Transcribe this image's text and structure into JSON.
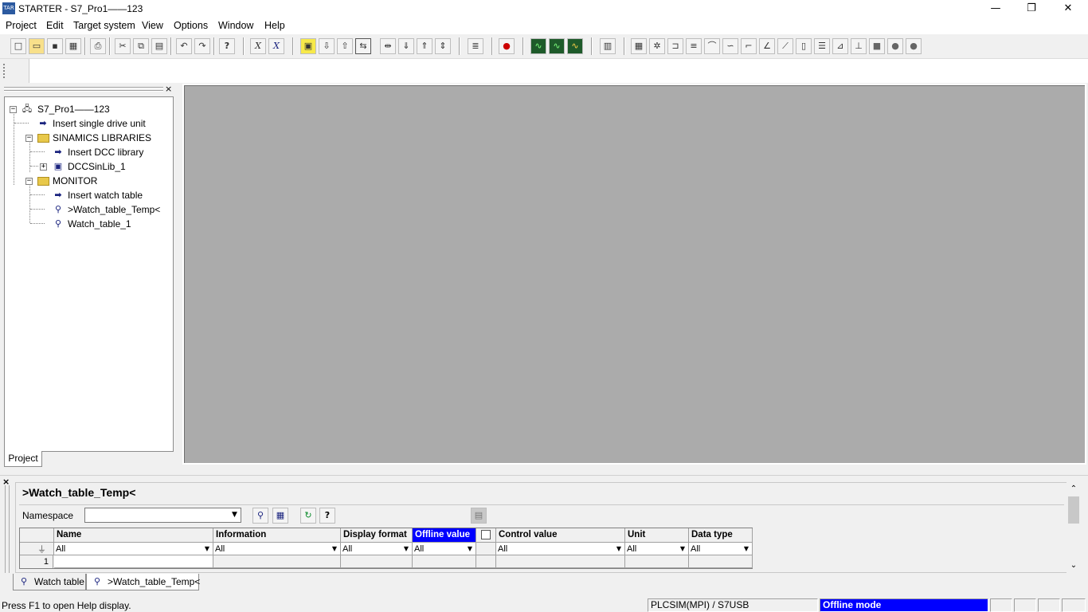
{
  "window": {
    "app_icon_text": "TAR",
    "title": "STARTER - S7_Pro1——123",
    "minimize": "—",
    "restore": "❐",
    "close": "✕"
  },
  "menu": [
    "Project",
    "Edit",
    "Target system",
    "View",
    "Options",
    "Window",
    "Help"
  ],
  "toolbar_icons": [
    "new-icon",
    "open-icon",
    "save-icon",
    "save-compile-icon",
    "print-icon",
    "cut-icon",
    "copy-icon",
    "paste-icon",
    "undo-icon",
    "redo-icon",
    "help-context-icon",
    "x-formula-icon",
    "x-formula-edit-icon",
    "accessible-nodes-icon",
    "load-icon",
    "upload-icon",
    "connect-icon",
    "disconnect-icon",
    "download-icon",
    "upload-cpu-icon",
    "transfer-icon",
    "compare-icon",
    "commissioning-icon",
    "trace-icon",
    "trace2-icon",
    "trace3-icon",
    "function-generator-icon",
    "param-icon",
    "gear-icon",
    "drive-icon",
    "lines-icon",
    "curve1-icon",
    "curve2-icon",
    "curve3-icon",
    "curve4-icon",
    "curve5-icon",
    "curve6-icon",
    "block-icon",
    "lines2-icon",
    "ramp1-icon",
    "ramp2-icon",
    "square-icon",
    "circle-icon",
    "circle2-icon"
  ],
  "project_tree": {
    "close_label": "×",
    "tab_label": "Project",
    "items": [
      {
        "label": "S7_Pro1——123",
        "expander": "−"
      },
      {
        "label": "Insert single drive unit"
      },
      {
        "label": "SINAMICS LIBRARIES",
        "expander": "−"
      },
      {
        "label": "Insert DCC library"
      },
      {
        "label": "DCCSinLib_1",
        "expander": "+"
      },
      {
        "label": "MONITOR",
        "expander": "−"
      },
      {
        "label": "Insert watch table"
      },
      {
        "label": ">Watch_table_Temp<"
      },
      {
        "label": "Watch_table_1"
      }
    ]
  },
  "detail": {
    "close_label": "×",
    "title": ">Watch_table_Temp<",
    "namespace_label": "Namespace",
    "namespace_value": "",
    "columns": [
      "Name",
      "Information",
      "Display format",
      "Offline value",
      "",
      "Control value",
      "Unit",
      "Data type"
    ],
    "filters": [
      "All",
      "All",
      "All",
      "All",
      "",
      "All",
      "All",
      "All"
    ],
    "row_number": "1",
    "tabs": [
      "Watch table",
      ">Watch_table_Temp<"
    ]
  },
  "status": {
    "help": "Press F1 to open Help display.",
    "connection": "PLCSIM(MPI) / S7USB",
    "mode": "Offline mode"
  },
  "colors": {
    "highlight": "#0000ff",
    "workspace": "#ababab"
  }
}
